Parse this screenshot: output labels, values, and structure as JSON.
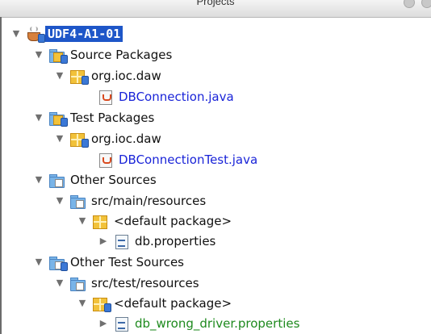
{
  "panel": {
    "title": "Projects"
  },
  "tree": {
    "project": "UDF4-A1-01",
    "source_packages": "Source Packages",
    "src_pkg_name": "org.ioc.daw",
    "src_file": "DBConnection.java",
    "test_packages": "Test Packages",
    "test_pkg_name": "org.ioc.daw",
    "test_file": "DBConnectionTest.java",
    "other_sources": "Other Sources",
    "main_resources": "src/main/resources",
    "default_pkg_main": "<default package>",
    "main_props": "db.properties",
    "other_test_sources": "Other Test Sources",
    "test_resources": "src/test/resources",
    "default_pkg_test": "<default package>",
    "test_props": "db_wrong_driver.properties"
  },
  "icons": {
    "expanded": "triangle-down-icon",
    "collapsed": "triangle-right-icon",
    "project": "maven-project-icon",
    "folder": "folder-icon",
    "package": "package-icon",
    "java": "java-file-icon",
    "properties": "properties-file-icon"
  },
  "colors": {
    "selection": "#1e56c8",
    "java_text": "#1a24d8",
    "props_text": "#1e8a1e"
  }
}
